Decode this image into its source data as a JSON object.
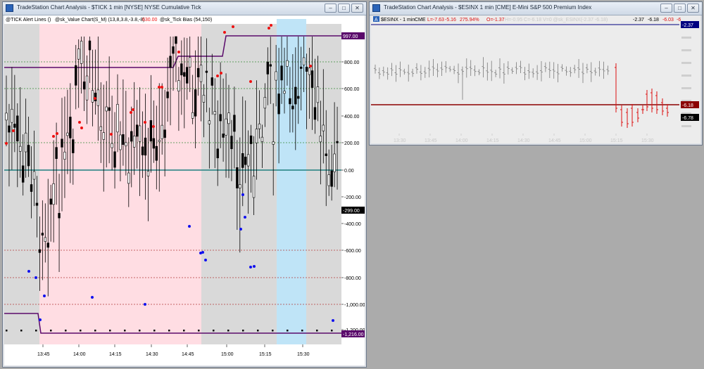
{
  "left_window": {
    "title": "TradeStation Chart Analysis - $TICK 1 min [NYSE] NYSE Cumulative Tick",
    "header": {
      "indicator1": "@TICK Alert Lines ()",
      "indicator2": "@sk_Value Chart(S_M) (13,8,3.8,-3.8,-8)",
      "indicator2_value": "630.00",
      "indicator3": "@sk_Tick Bias (54,150)"
    },
    "y_ticks": [
      "997.00",
      "800.00",
      "600.00",
      "400.00",
      "200.00",
      "0.00",
      "-200.00",
      "-299.00",
      "-400.00",
      "-600.00",
      "-800.00",
      "-1,000.00",
      "-1,200.00",
      "-1,216.00"
    ],
    "x_ticks": [
      "13:45",
      "14:00",
      "14:15",
      "14:30",
      "14:45",
      "15:00",
      "15:15",
      "15:30"
    ],
    "colors": {
      "pink_zone": "#ffdde3",
      "blue_zone": "#bfe4f7",
      "grey_zone": "#d9d9d9",
      "cumulative_line": "#5a0a6b",
      "zero_line": "#1f7f7f",
      "red_dot": "#ee1111",
      "blue_dot": "#1111ee"
    }
  },
  "right_window": {
    "title": "TradeStation Chart Analysis - $ESINX 1 min [CME] E-Mini S&P 500 Premium Index",
    "header": {
      "badge": "A",
      "symbol": "$ESINX - 1 min",
      "exchange": "CME",
      "low": "L=-7.63",
      "mid": "-5.16",
      "pct": "275.94%",
      "open": "O=-1.37",
      "faded": "H=-0.95  C=-6.18  V=0  @sk_ESINX(-2.37 -6.18)",
      "v1": "-2.37",
      "v2": "-6.18",
      "v3": "-6.03",
      "v4": "-6"
    },
    "y_ticks": [
      "-2.37",
      "-6.18",
      "-6.78"
    ],
    "x_ticks": [
      "13:30",
      "13:45",
      "14:00",
      "14:15",
      "14:30",
      "14:45",
      "15:00",
      "15:15",
      "15:30"
    ],
    "colors": {
      "bar_grey": "#7a7a7a",
      "bar_red": "#dd1111",
      "navy_line": "#000080",
      "maroon_line": "#8b0000"
    }
  },
  "window_controls": {
    "minimize": "–",
    "maximize": "□",
    "close": "✕"
  }
}
